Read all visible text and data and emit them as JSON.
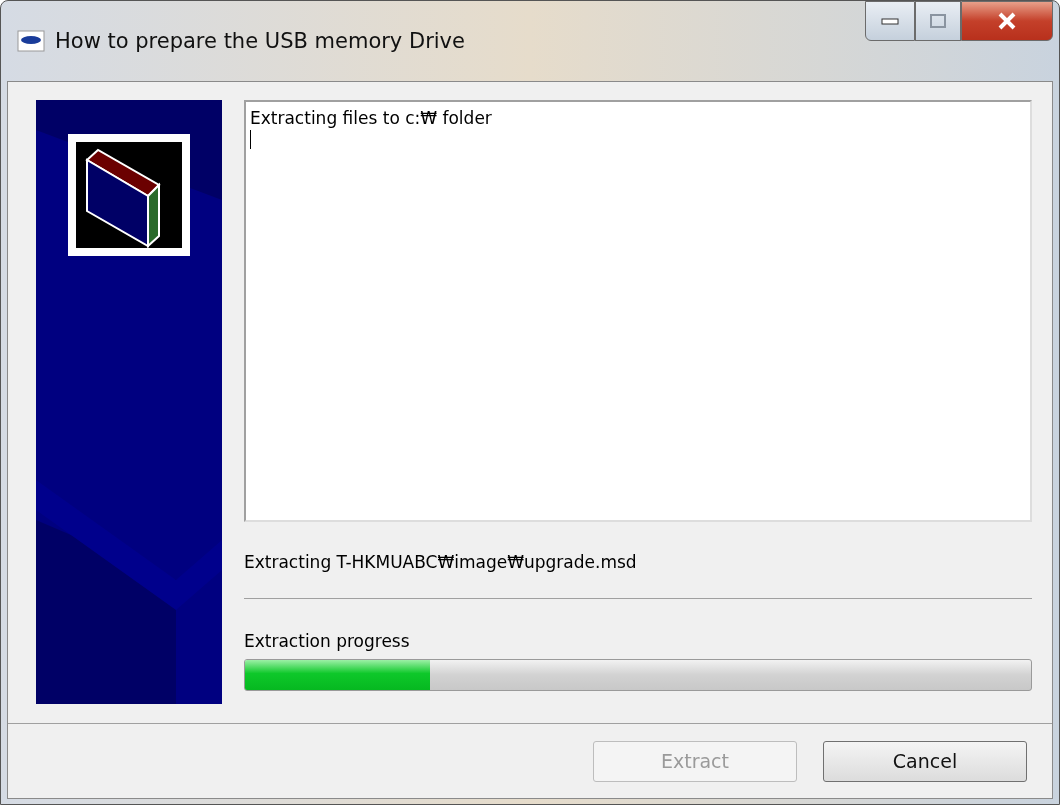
{
  "window": {
    "title": "How to prepare the USB memory Drive"
  },
  "log": {
    "lines": [
      "Extracting files to c:₩ folder"
    ],
    "caret": true
  },
  "status": "Extracting T-HKMUABC₩image₩upgrade.msd",
  "progress": {
    "label": "Extraction progress",
    "level": 0.235
  },
  "buttons": [
    {
      "label": "Extract",
      "disabled": true
    },
    {
      "label": "Cancel",
      "disabled": false
    }
  ]
}
